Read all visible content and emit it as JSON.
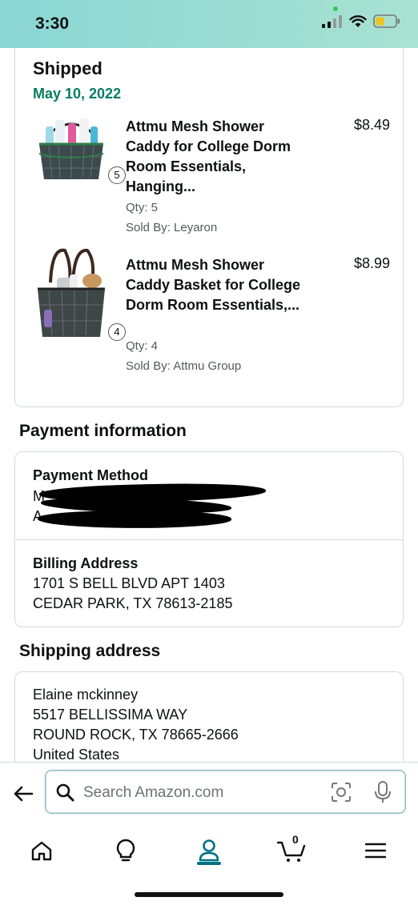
{
  "status_bar": {
    "time": "3:30"
  },
  "shipment": {
    "title": "Shipped",
    "date": "May 10, 2022",
    "items": [
      {
        "title": "Attmu Mesh Shower Caddy for College Dorm Room Essentials, Hanging...",
        "price": "$8.49",
        "qty": "Qty: 5",
        "sold_by": "Sold By: Leyaron",
        "badge": "5"
      },
      {
        "title": "Attmu Mesh Shower Caddy Basket for College Dorm Room Essentials,...",
        "price": "$8.99",
        "qty": "Qty: 4",
        "sold_by": "Sold By: Attmu Group",
        "badge": "4"
      }
    ]
  },
  "payment": {
    "heading": "Payment information",
    "method_label": "Payment Method",
    "method_line1_visible": "M",
    "method_line2_visible": "A",
    "billing_label": "Billing Address",
    "billing_line1": "1701 S BELL BLVD APT 1403",
    "billing_line2": "CEDAR PARK, TX 78613-2185"
  },
  "shipping": {
    "heading": "Shipping address",
    "name": "Elaine mckinney",
    "line1": "5517 BELLISSIMA WAY",
    "line2": "ROUND ROCK, TX 78665-2666",
    "country": "United States"
  },
  "search": {
    "placeholder": "Search Amazon.com"
  },
  "tabs": {
    "cart_count": "0",
    "items": [
      "home",
      "inspire",
      "account",
      "cart",
      "menu"
    ],
    "active": "account"
  },
  "colors": {
    "accent": "#007185",
    "date_green": "#067d62",
    "status_bar": "#8ad6d4"
  }
}
